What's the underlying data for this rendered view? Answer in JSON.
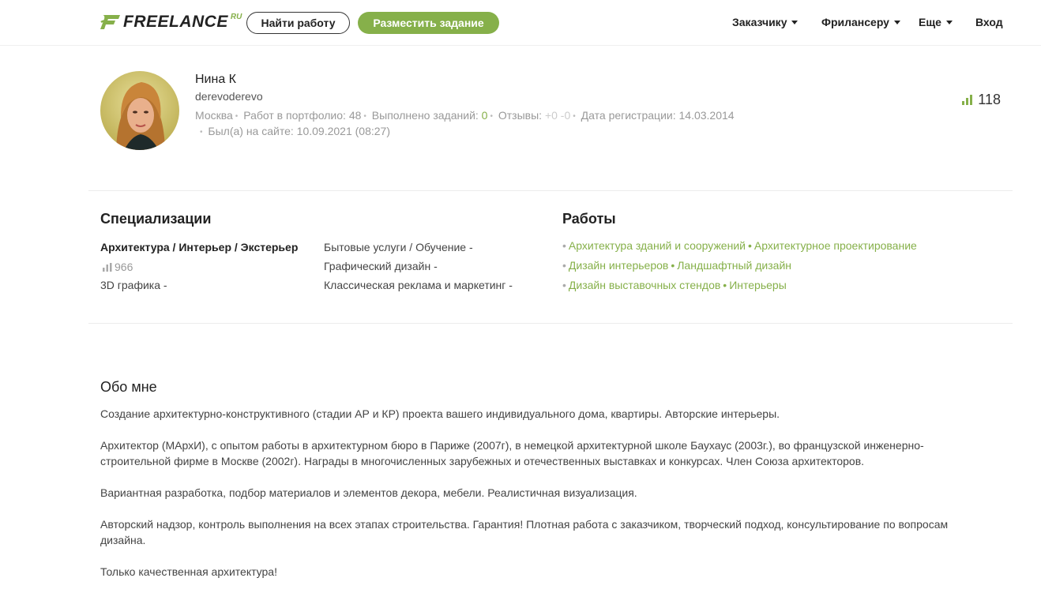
{
  "header": {
    "logo_text": "FREELANCE",
    "logo_suffix": "RU",
    "find_work": "Найти работу",
    "post_task": "Разместить задание",
    "nav": [
      "Заказчику",
      "Фрилансеру",
      "Еще"
    ],
    "login": "Вход",
    "accent": "#86b04a"
  },
  "profile": {
    "name": "Нина К",
    "username": "derevoderevo",
    "city": "Москва",
    "portfolio_label": "Работ в портфолио:",
    "portfolio_count": "48",
    "done_label": "Выполнено заданий:",
    "done_count": "0",
    "reviews_label": "Отзывы:",
    "reviews_value": "+0 -0",
    "reg_label": "Дата регистрации:",
    "reg_date": "14.03.2014",
    "last_seen": "Был(а) на сайте: 10.09.2021 (08:27)",
    "rating": "118"
  },
  "specializations": {
    "title": "Специализации",
    "primary": "Архитектура / Интерьер / Экстерьер",
    "primary_rating": "966",
    "col1": [
      "3D графика -"
    ],
    "col2": [
      "Бытовые услуги / Обучение -",
      "Графический дизайн -",
      "Классическая реклама и маркетинг -"
    ]
  },
  "works": {
    "title": "Работы",
    "rows": [
      [
        "Архитектура зданий и сооружений",
        "Архитектурное проектирование"
      ],
      [
        "Дизайн интерьеров",
        "Ландшафтный дизайн"
      ],
      [
        "Дизайн выставочных стендов",
        "Интерьеры"
      ]
    ]
  },
  "about": {
    "title": "Обо мне",
    "paragraphs": [
      "Создание архитектурно-конструктивного (стадии АР и КР) проекта вашего индивидуального дома, квартиры. Авторские интерьеры.",
      "Архитектор (МАрхИ), с опытом работы в архитектурном бюро в Париже (2007г), в немецкой архитектурной школе Баухаус (2003г.), во французской инженерно-строительной фирме в Москве (2002г). Награды в многочисленных зарубежных и отечественных выставках и конкурсах. Член Союза архитекторов.",
      "Вариантная разработка, подбор материалов и элементов декора, мебели. Реалистичная визуализация.",
      "Авторский надзор, контроль выполнения на всех этапах строительства. Гарантия! Плотная работа с заказчиком, творческий подход, консультирование по вопросам дизайна.",
      "Только качественная архитектура!"
    ]
  }
}
